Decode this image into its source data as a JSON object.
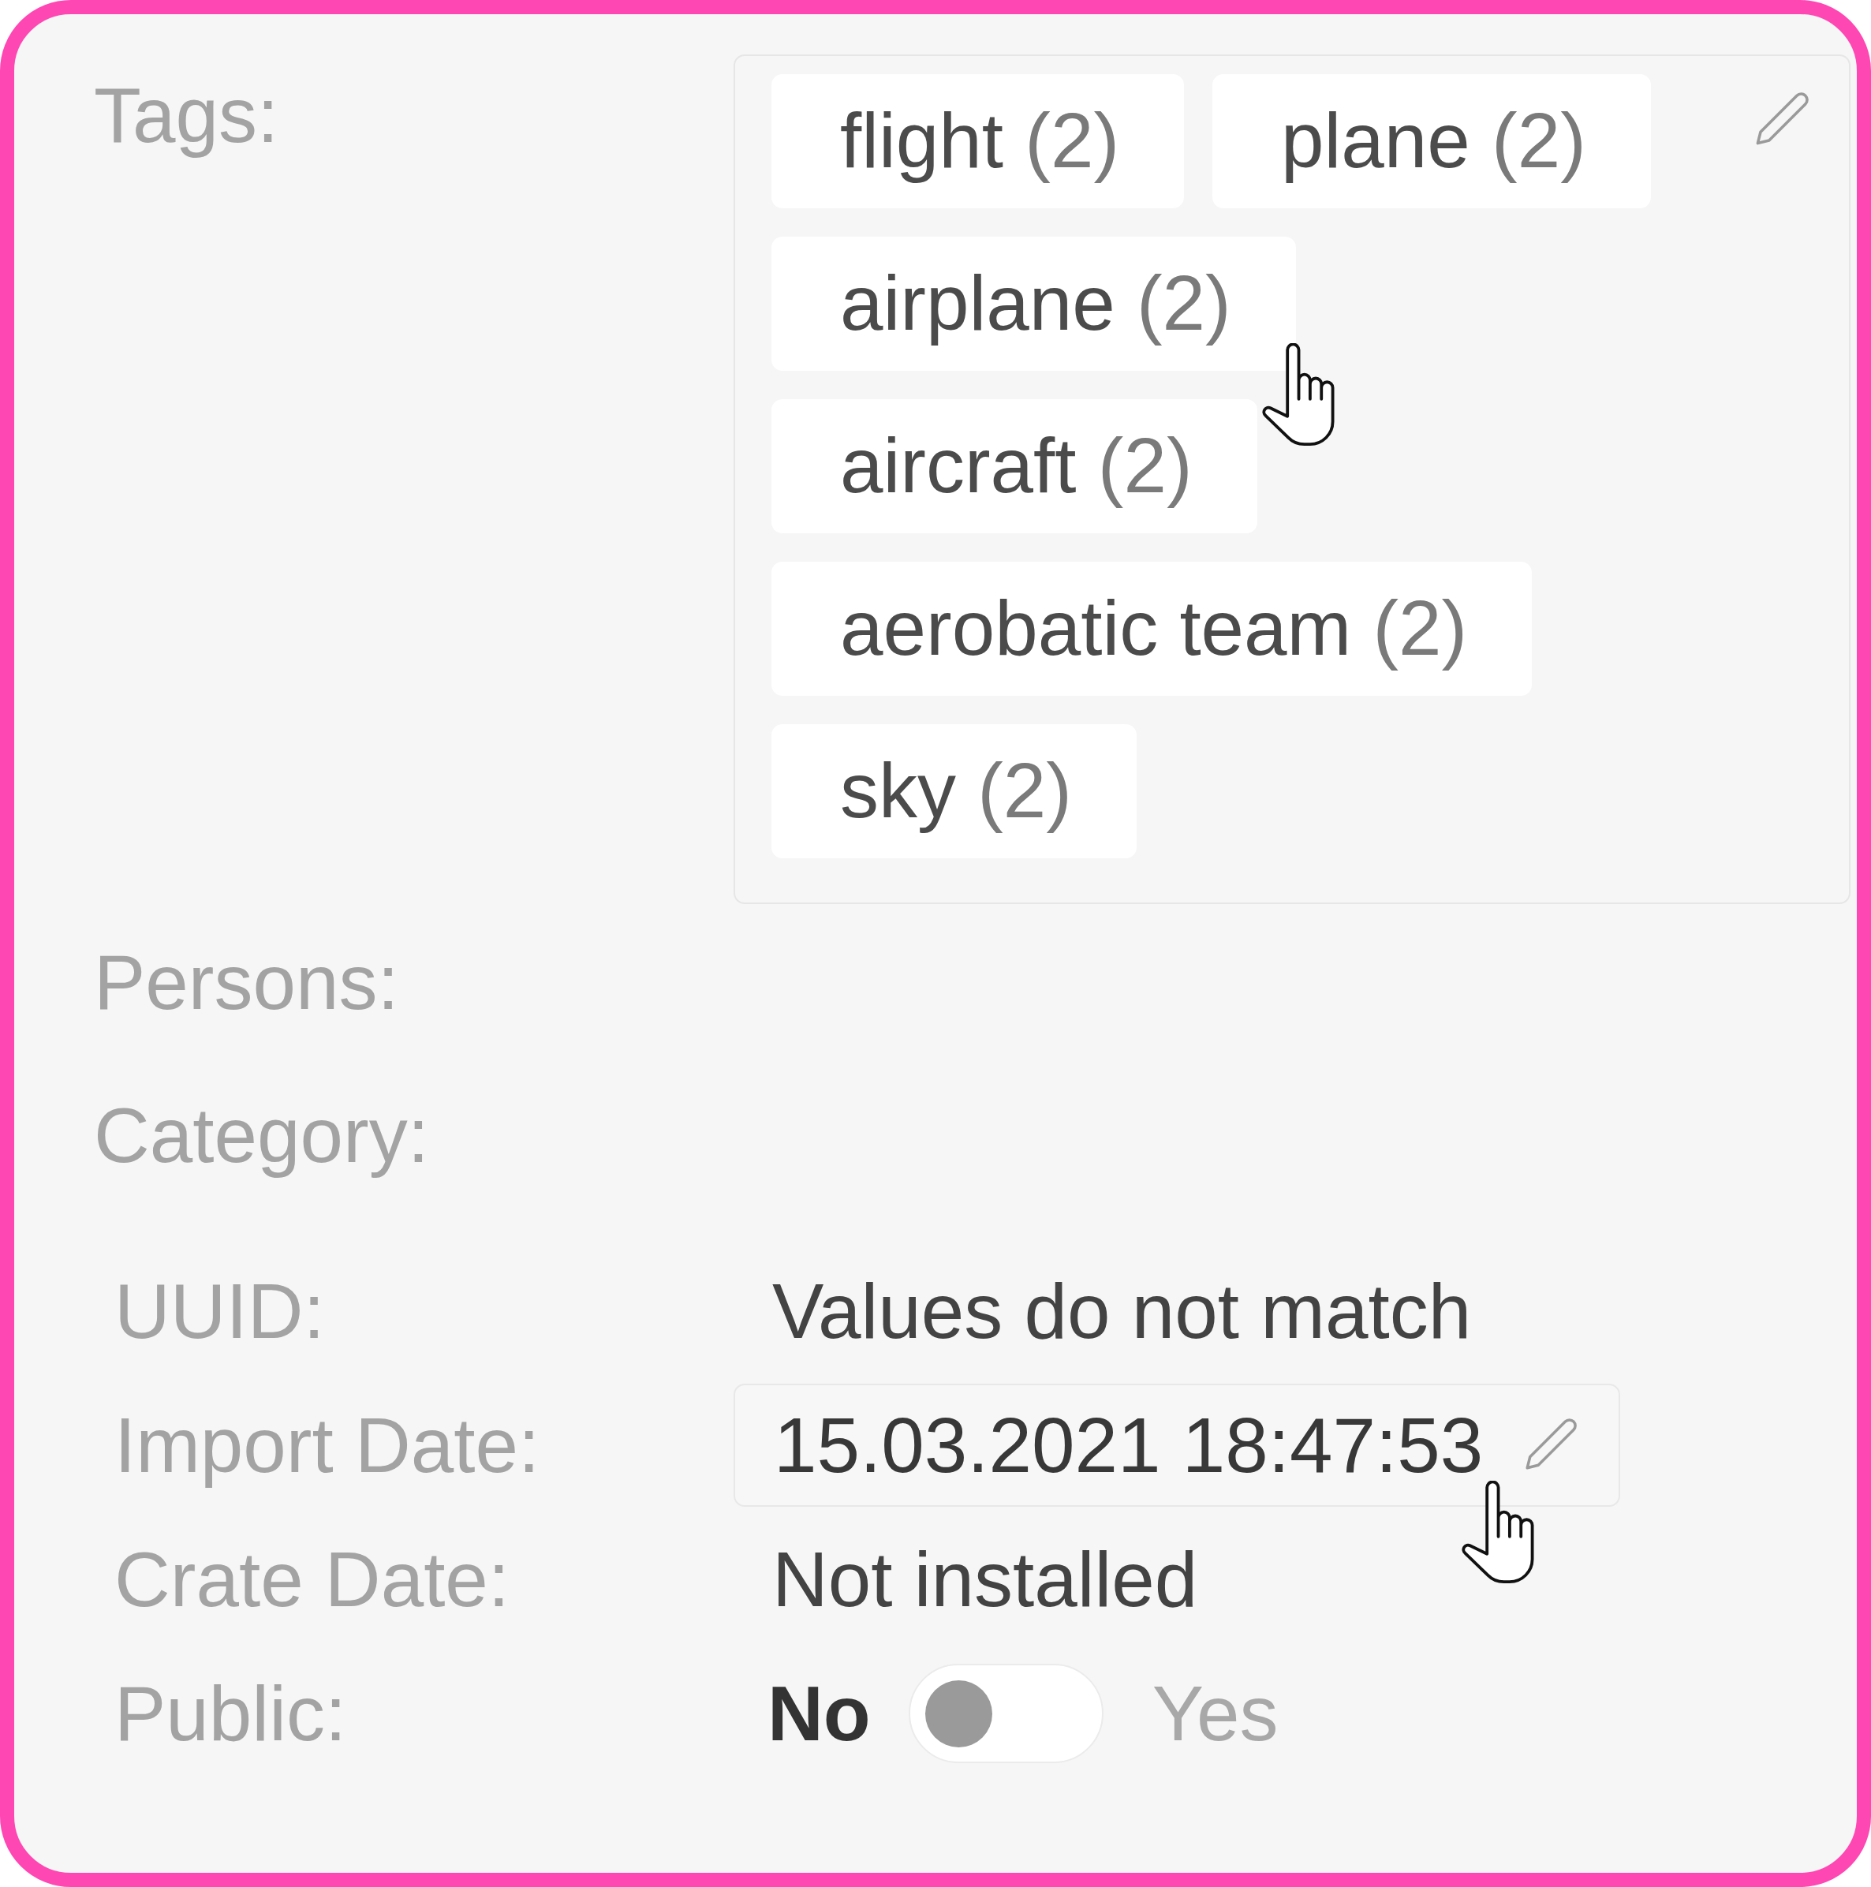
{
  "fields": [
    {
      "kind": "tags",
      "label": "Tags:",
      "tags": [
        {
          "name": "flight",
          "count": "(2)"
        },
        {
          "name": "plane",
          "count": "(2)"
        },
        {
          "name": "airplane",
          "count": "(2)"
        },
        {
          "name": "aircraft",
          "count": "(2)"
        },
        {
          "name": "aerobatic team",
          "count": "(2)"
        },
        {
          "name": "sky",
          "count": "(2)"
        }
      ]
    },
    {
      "kind": "empty",
      "label": "Persons:"
    },
    {
      "kind": "empty",
      "label": "Category:"
    }
  ],
  "properties": [
    {
      "kind": "text",
      "label": "UUID:",
      "value": "Values do not match"
    },
    {
      "kind": "editable",
      "label": "Import Date:",
      "value": "15.03.2021 18:47:53"
    },
    {
      "kind": "text",
      "label": "Crate Date:",
      "value": "Not installed"
    },
    {
      "kind": "toggle",
      "label": "Public:",
      "off_label": "No",
      "on_label": "Yes",
      "on": false
    }
  ]
}
